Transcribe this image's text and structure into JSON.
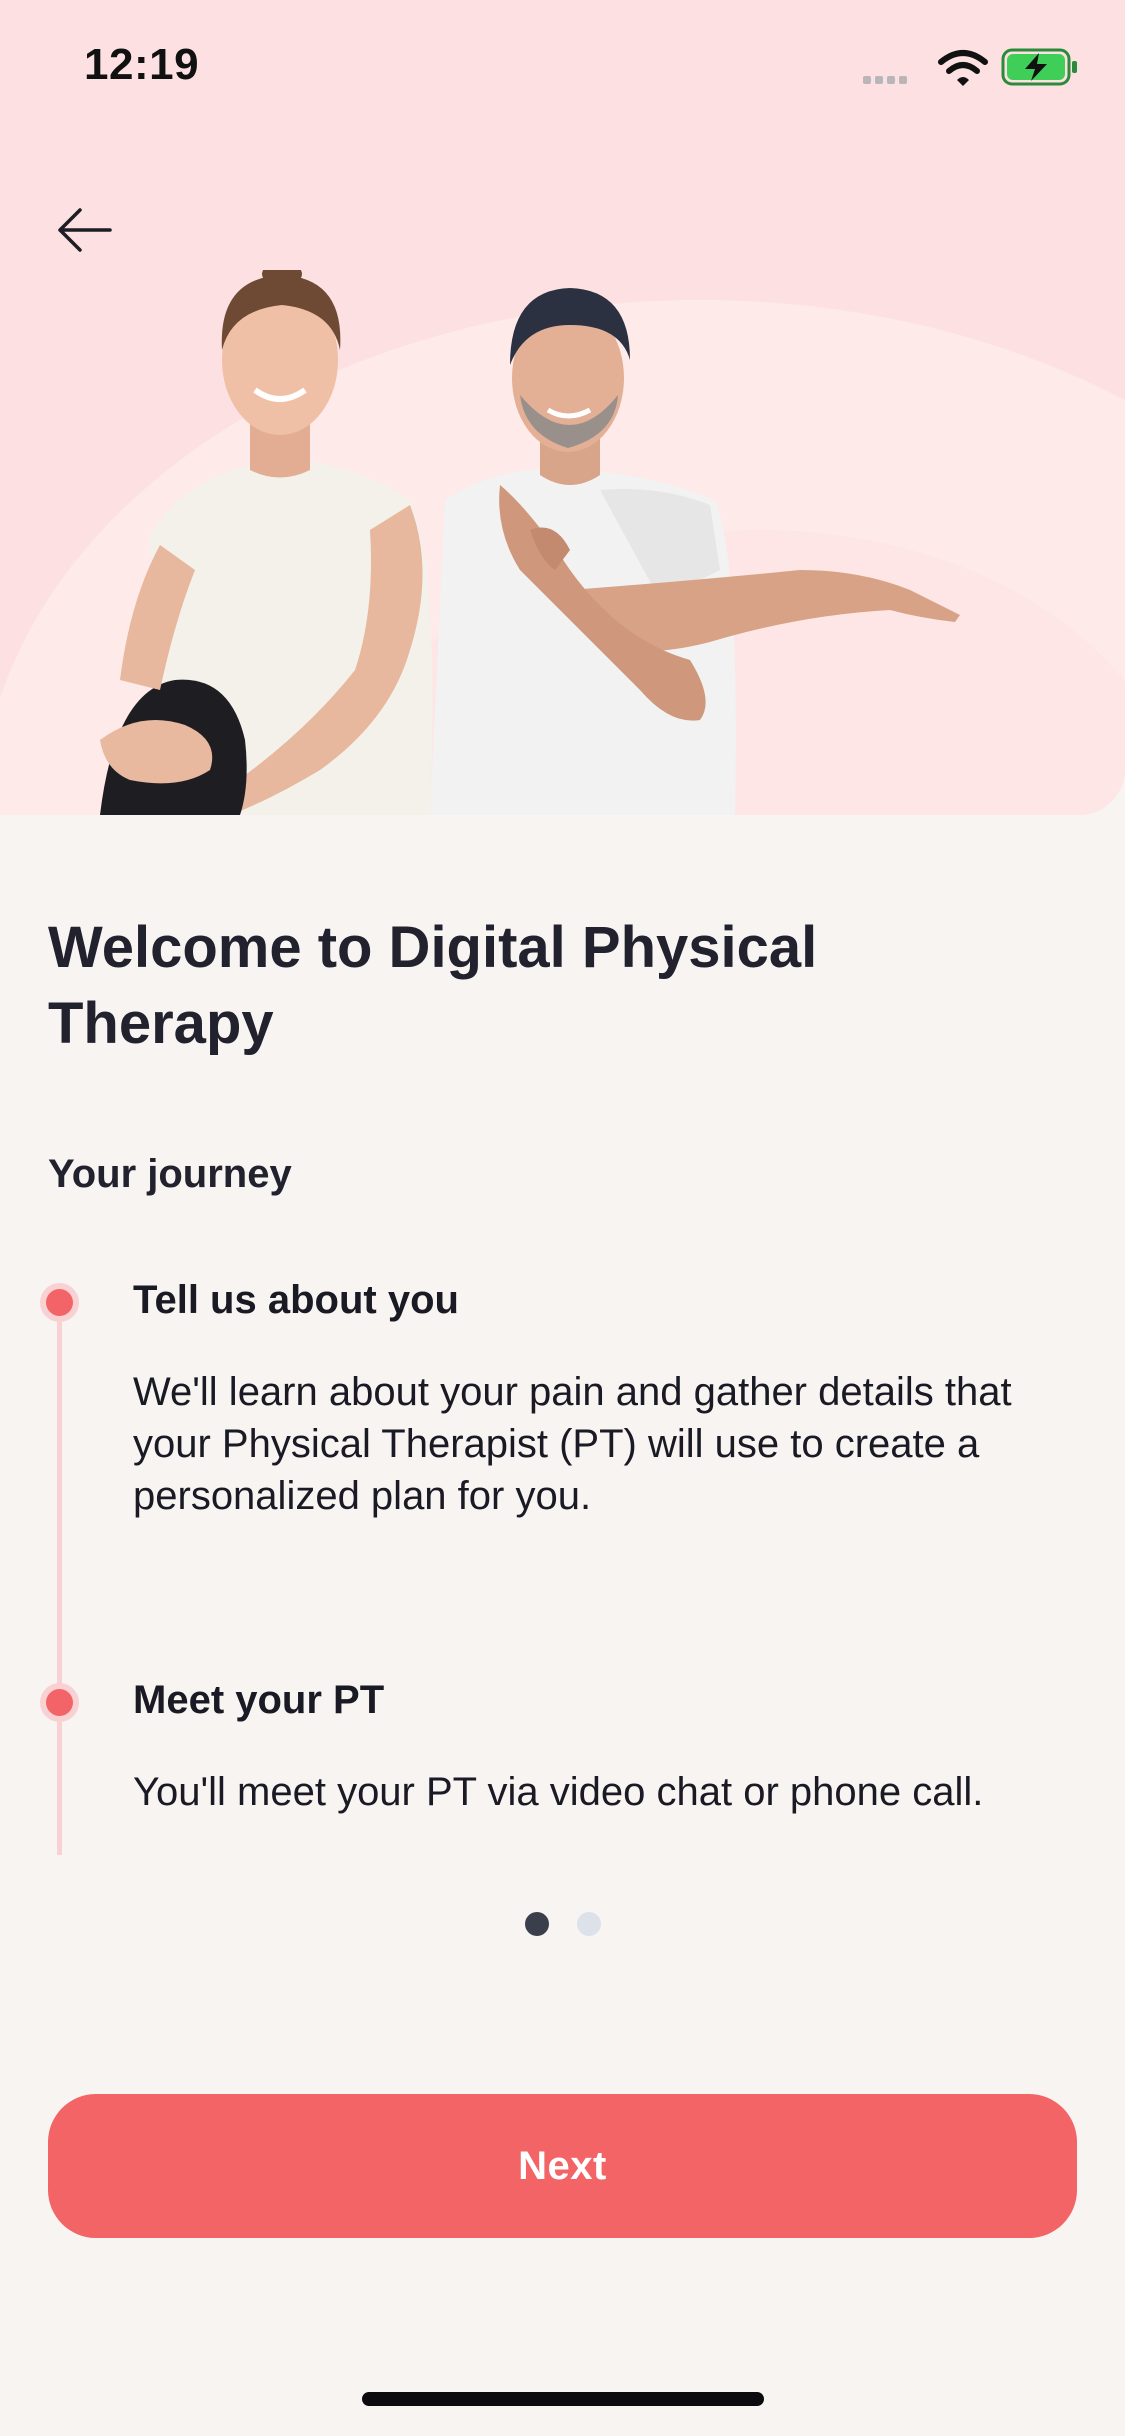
{
  "status_bar": {
    "time": "12:19",
    "icons": [
      "signal-icon",
      "wifi-icon",
      "battery-charging-icon"
    ]
  },
  "header": {
    "back_icon": "arrow-left-icon"
  },
  "hero": {
    "image": "two-people-stretching-illustration",
    "background_color": "#fde1e2"
  },
  "main": {
    "title": "Welcome to Digital Physical Therapy",
    "section_label": "Your journey",
    "steps": [
      {
        "title": "Tell us about you",
        "description": "We'll learn about your pain and gather details that your Physical Therapist (PT) will use to create a personalized plan for you."
      },
      {
        "title": "Meet your PT",
        "description": "You'll meet your PT via video chat or phone call."
      }
    ]
  },
  "pager": {
    "total_pages": 2,
    "current_page": 1
  },
  "footer": {
    "next_label": "Next"
  },
  "colors": {
    "accent": "#f26466",
    "timeline_line": "#f9d1d3",
    "background": "#f8f4f2",
    "text": "#22222f",
    "pager_active": "#3b3f4c",
    "pager_inactive": "#dde1ea"
  }
}
